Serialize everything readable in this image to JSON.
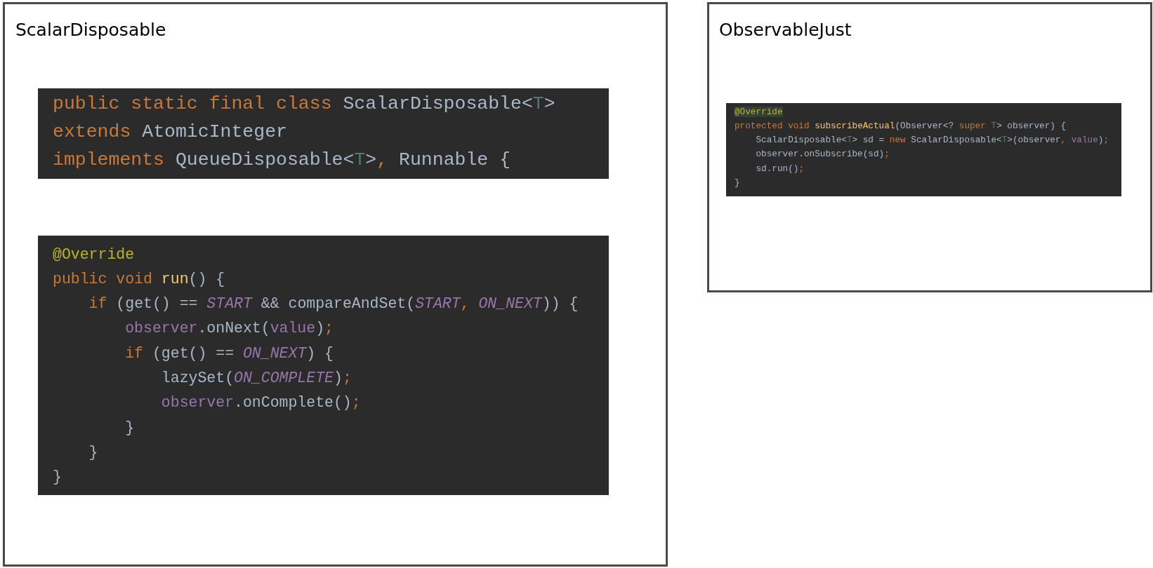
{
  "panels": [
    {
      "title": "ScalarDisposable",
      "snippets": [
        {
          "lines": [
            [
              {
                "kind": "keyword",
                "text": "public static final class "
              },
              {
                "kind": "plain",
                "text": "ScalarDisposable<"
              },
              {
                "kind": "type_param",
                "text": "T"
              },
              {
                "kind": "plain",
                "text": ">"
              }
            ],
            [
              {
                "kind": "keyword",
                "text": "extends "
              },
              {
                "kind": "plain",
                "text": "AtomicInteger"
              }
            ],
            [
              {
                "kind": "keyword",
                "text": "implements "
              },
              {
                "kind": "plain",
                "text": "QueueDisposable<"
              },
              {
                "kind": "type_param",
                "text": "T"
              },
              {
                "kind": "plain",
                "text": ">"
              },
              {
                "kind": "punct",
                "text": ", "
              },
              {
                "kind": "plain",
                "text": "Runnable {"
              }
            ]
          ]
        },
        {
          "lines": [
            [
              {
                "kind": "annotation",
                "text": "@Override"
              }
            ],
            [
              {
                "kind": "keyword",
                "text": "public void "
              },
              {
                "kind": "method",
                "text": "run"
              },
              {
                "kind": "plain",
                "text": "() {"
              }
            ],
            [
              {
                "kind": "keyword",
                "text": "    if "
              },
              {
                "kind": "plain",
                "text": "(get() == "
              },
              {
                "kind": "constant",
                "text": "START"
              },
              {
                "kind": "plain",
                "text": " && compareAndSet("
              },
              {
                "kind": "constant",
                "text": "START"
              },
              {
                "kind": "punct",
                "text": ", "
              },
              {
                "kind": "constant",
                "text": "ON_NEXT"
              },
              {
                "kind": "plain",
                "text": ")) {"
              }
            ],
            [
              {
                "kind": "field",
                "text": "        observer"
              },
              {
                "kind": "plain",
                "text": ".onNext("
              },
              {
                "kind": "field",
                "text": "value"
              },
              {
                "kind": "plain",
                "text": ")"
              },
              {
                "kind": "punct",
                "text": ";"
              }
            ],
            [
              {
                "kind": "keyword",
                "text": "        if "
              },
              {
                "kind": "plain",
                "text": "(get() == "
              },
              {
                "kind": "constant",
                "text": "ON_NEXT"
              },
              {
                "kind": "plain",
                "text": ") {"
              }
            ],
            [
              {
                "kind": "plain",
                "text": "            lazySet("
              },
              {
                "kind": "constant",
                "text": "ON_COMPLETE"
              },
              {
                "kind": "plain",
                "text": ")"
              },
              {
                "kind": "punct",
                "text": ";"
              }
            ],
            [
              {
                "kind": "field",
                "text": "            observer"
              },
              {
                "kind": "plain",
                "text": ".onComplete()"
              },
              {
                "kind": "punct",
                "text": ";"
              }
            ],
            [
              {
                "kind": "plain",
                "text": "        }"
              }
            ],
            [
              {
                "kind": "plain",
                "text": "    }"
              }
            ],
            [
              {
                "kind": "plain",
                "text": "}"
              }
            ]
          ]
        }
      ]
    },
    {
      "title": "ObservableJust",
      "snippets": [
        {
          "lines": [
            [
              {
                "kind": "annotation_marked",
                "text": "@Override"
              }
            ],
            [
              {
                "kind": "keyword",
                "text": "protected void "
              },
              {
                "kind": "method",
                "text": "subscribeActual"
              },
              {
                "kind": "plain",
                "text": "(Observer<? "
              },
              {
                "kind": "keyword",
                "text": "super "
              },
              {
                "kind": "type_param",
                "text": "T"
              },
              {
                "kind": "plain",
                "text": "> observer) {"
              }
            ],
            [
              {
                "kind": "plain",
                "text": "    ScalarDisposable<"
              },
              {
                "kind": "type_param",
                "text": "T"
              },
              {
                "kind": "plain",
                "text": "> sd = "
              },
              {
                "kind": "keyword",
                "text": "new "
              },
              {
                "kind": "plain",
                "text": "ScalarDisposable<"
              },
              {
                "kind": "type_param",
                "text": "T"
              },
              {
                "kind": "plain",
                "text": ">(observer"
              },
              {
                "kind": "punct",
                "text": ", "
              },
              {
                "kind": "field",
                "text": "value"
              },
              {
                "kind": "plain",
                "text": ")"
              },
              {
                "kind": "punct",
                "text": ";"
              }
            ],
            [
              {
                "kind": "plain",
                "text": "    observer.onSubscribe(sd)"
              },
              {
                "kind": "punct",
                "text": ";"
              }
            ],
            [
              {
                "kind": "plain",
                "text": "    sd.run()"
              },
              {
                "kind": "punct",
                "text": ";"
              }
            ],
            [
              {
                "kind": "plain",
                "text": "}"
              }
            ]
          ]
        }
      ]
    }
  ]
}
